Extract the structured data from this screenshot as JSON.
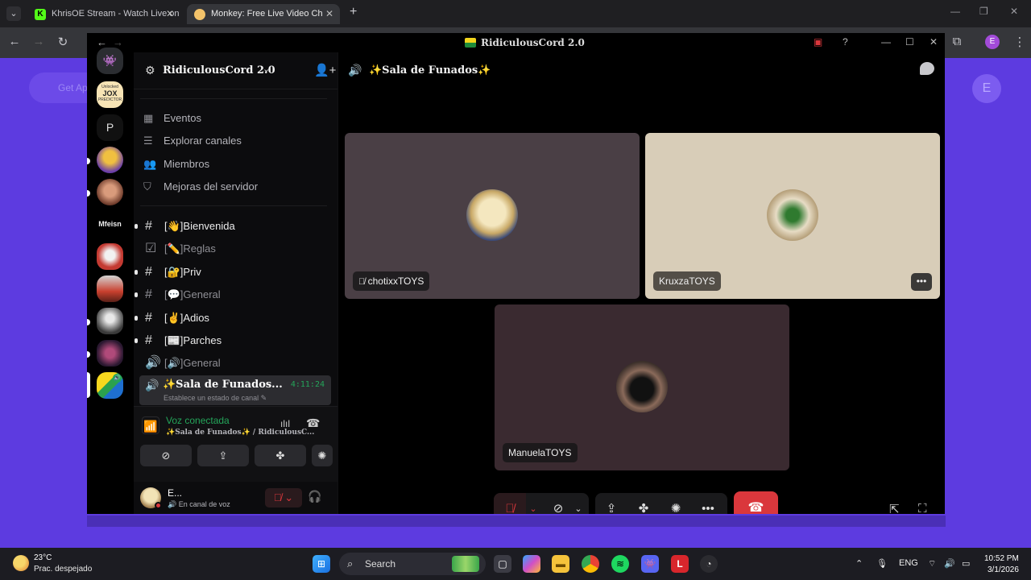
{
  "browser": {
    "tabs": [
      {
        "title": "KhrisOE Stream - Watch Live on",
        "favicon_color": "#53fc18"
      },
      {
        "title": "Monkey: Free Live Video Ch",
        "favicon_color": "#f3c36a"
      }
    ],
    "page_button": "Get Ap",
    "page_avatar": "E",
    "profile_initial": "E"
  },
  "discord": {
    "window_title": "RidiculousCord 2.0",
    "server_name": "RidiculousCord 2.0",
    "rail": {
      "jox_line1": "Unlocked",
      "jox_line2": "JOX",
      "jox_line3": "PREDICTOR",
      "p_initial": "P",
      "mfeisn": "Mfeisn"
    },
    "nav_items": [
      {
        "label": "Eventos",
        "icon": "calendar-icon"
      },
      {
        "label": "Explorar canales",
        "icon": "list-icon"
      },
      {
        "label": "Miembros",
        "icon": "members-icon"
      },
      {
        "label": "Mejoras del servidor",
        "icon": "boost-icon"
      }
    ],
    "channels": [
      {
        "name": "[👋]Bienvenida",
        "type": "text"
      },
      {
        "name": "[✏️]Reglas",
        "type": "rules"
      },
      {
        "name": "[🔐]Priv",
        "type": "text"
      },
      {
        "name": "[💬]General",
        "type": "text"
      },
      {
        "name": "[✌️]Adios",
        "type": "text"
      },
      {
        "name": "[📰]Parches",
        "type": "text"
      },
      {
        "name": "[🔊]General",
        "type": "voice"
      }
    ],
    "active_channel": {
      "name": "✨Sala de Funados...",
      "timer": "4:11:24",
      "status": "Establece un estado de canal ✎"
    },
    "voice": {
      "title": "Voz conectada",
      "subtitle": "✨Sala de Funados✨ / RidiculousC..."
    },
    "user": {
      "name": "E...",
      "status": "En canal de voz"
    },
    "stage": {
      "title": "✨Sala de Funados✨",
      "participants": [
        {
          "name": "chotixxTOYS",
          "muted": true,
          "tile_color": "#4a3f45"
        },
        {
          "name": "KruxzaTOYS",
          "muted": false,
          "tile_color": "#d8cdb8"
        },
        {
          "name": "ManuelaTOYS",
          "muted": false,
          "tile_color": "#3a2a30"
        }
      ]
    }
  },
  "taskbar": {
    "temperature": "23°C",
    "weather": "Prac. despejado",
    "search_placeholder": "Search",
    "language": "ENG",
    "time": "10:52 PM",
    "date": "3/1/2026"
  }
}
